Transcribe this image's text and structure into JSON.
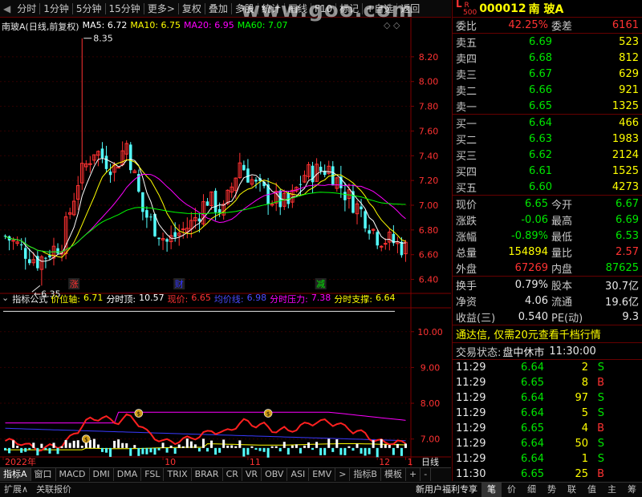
{
  "toolbar": {
    "tabs": [
      "分时",
      "1分钟",
      "5分钟",
      "15分钟",
      "更多>"
    ],
    "buttons": [
      "复权",
      "叠加",
      "多股",
      "统计",
      "画线",
      "F10",
      "标记",
      "+自选",
      "返回"
    ]
  },
  "watermark": "www.goo.com",
  "legend": {
    "title": "南玻A(日线,前复权)",
    "items": [
      {
        "label": "MA5: 6.72",
        "color": "#ffffff"
      },
      {
        "label": "MA10: 6.75",
        "color": "#ffff00"
      },
      {
        "label": "MA20: 6.95",
        "color": "#ff00ff"
      },
      {
        "label": "MA60: 7.07",
        "color": "#00ff00"
      }
    ]
  },
  "indicator_legend": {
    "name": "指标公式",
    "items": [
      {
        "label": "价位轴:",
        "value": "6.71",
        "color": "#ffff00"
      },
      {
        "label": "分时顶:",
        "value": "10.57",
        "color": "#ffffff"
      },
      {
        "label": "现价:",
        "value": "6.65",
        "color": "#ff3232"
      },
      {
        "label": "均价线:",
        "value": "6.98",
        "color": "#3232ff"
      },
      {
        "label": "分时压力:",
        "value": "7.38",
        "color": "#ff00ff"
      },
      {
        "label": "分时支撑:",
        "value": "6.64",
        "color": "#ffff00"
      }
    ]
  },
  "chart_data": [
    {
      "type": "candlestick",
      "ylim": [
        6.3,
        8.4
      ],
      "yticks": [
        "8.20",
        "8.00",
        "7.80",
        "7.60",
        "7.40",
        "7.20",
        "7.00",
        "6.80",
        "6.60",
        "6.40"
      ],
      "ytick_values": [
        8.2,
        8.0,
        7.8,
        7.6,
        7.4,
        7.2,
        7.0,
        6.8,
        6.6,
        6.4
      ],
      "annotations": [
        {
          "text": "8.35",
          "kind": "high"
        },
        {
          "text": "6.35",
          "kind": "low"
        }
      ],
      "markers": [
        {
          "text": "涨",
          "color": "#ff3232"
        },
        {
          "text": "财",
          "color": "#3232ff"
        },
        {
          "text": "减",
          "color": "#00e600"
        }
      ],
      "ma_colors": {
        "ma5": "#ffffff",
        "ma10": "#ffff00",
        "ma20": "#ff00ff",
        "ma60": "#00ff00"
      }
    },
    {
      "type": "line",
      "ylim": [
        6.5,
        10.6
      ],
      "yticks": [
        "10.00",
        "9.00",
        "8.00",
        "7.00"
      ],
      "ytick_values": [
        10,
        9,
        8,
        7
      ]
    }
  ],
  "xaxis": {
    "labels": [
      "2022年",
      "10",
      "11",
      "12",
      "1"
    ],
    "right_label": "日线"
  },
  "bottom_tabs": [
    "指标A",
    "窗口",
    "MACD",
    "DMI",
    "DMA",
    "FSL",
    "TRIX",
    "BRAR",
    "CR",
    "VR",
    "OBV",
    "ASI",
    "EMV",
    ">",
    "指标B",
    "模板",
    "+",
    "-"
  ],
  "statusbar": {
    "items": [
      "扩展∧",
      "关联报价"
    ],
    "right": "新用户福利专享"
  },
  "side_tabs": [
    "笔",
    "价",
    "细",
    "势",
    "联",
    "值",
    "主",
    "筹"
  ],
  "quote": {
    "header": {
      "badge_l": "L",
      "badge_r": "R",
      "badge_sub": "500",
      "code": "000012",
      "name": "南 玻A"
    },
    "weibi": {
      "label": "委比",
      "value": "42.25%",
      "label2": "委差",
      "value2": "6161"
    },
    "asks": [
      {
        "label": "卖五",
        "price": "6.69",
        "vol": "523"
      },
      {
        "label": "卖四",
        "price": "6.68",
        "vol": "812"
      },
      {
        "label": "卖三",
        "price": "6.67",
        "vol": "629"
      },
      {
        "label": "卖二",
        "price": "6.66",
        "vol": "921"
      },
      {
        "label": "卖一",
        "price": "6.65",
        "vol": "1325"
      }
    ],
    "bids": [
      {
        "label": "买一",
        "price": "6.64",
        "vol": "466"
      },
      {
        "label": "买二",
        "price": "6.63",
        "vol": "1983"
      },
      {
        "label": "买三",
        "price": "6.62",
        "vol": "2124"
      },
      {
        "label": "买四",
        "price": "6.61",
        "vol": "1525"
      },
      {
        "label": "买五",
        "price": "6.60",
        "vol": "4273"
      }
    ],
    "stats": [
      {
        "l1": "现价",
        "v1": "6.65",
        "c1": "green",
        "l2": "今开",
        "v2": "6.67",
        "c2": "green"
      },
      {
        "l1": "涨跌",
        "v1": "-0.06",
        "c1": "green",
        "l2": "最高",
        "v2": "6.69",
        "c2": "green"
      },
      {
        "l1": "涨幅",
        "v1": "-0.89%",
        "c1": "green",
        "l2": "最低",
        "v2": "6.53",
        "c2": "green"
      },
      {
        "l1": "总量",
        "v1": "154894",
        "c1": "yellow",
        "l2": "量比",
        "v2": "2.57",
        "c2": "red"
      },
      {
        "l1": "外盘",
        "v1": "67269",
        "c1": "red",
        "l2": "内盘",
        "v2": "87625",
        "c2": "green"
      }
    ],
    "stats2": [
      {
        "l1": "换手",
        "v1": "0.79%",
        "l2": "股本",
        "v2": "30.7亿"
      },
      {
        "l1": "净资",
        "v1": "4.06",
        "l2": "流通",
        "v2": "19.6亿"
      },
      {
        "l1": "收益(三)",
        "v1": "0.540",
        "l2": "PE(动)",
        "v2": "9.3"
      }
    ],
    "ad": "通达信, 仅需20元查看千档行情",
    "trade_state": {
      "label": "交易状态:",
      "value": "盘中休市",
      "time": "11:30:00"
    },
    "ticks": [
      {
        "time": "11:29",
        "price": "6.64",
        "vol": "2",
        "side": "S"
      },
      {
        "time": "11:29",
        "price": "6.65",
        "vol": "8",
        "side": "B"
      },
      {
        "time": "11:29",
        "price": "6.64",
        "vol": "97",
        "side": "S"
      },
      {
        "time": "11:29",
        "price": "6.64",
        "vol": "5",
        "side": "S"
      },
      {
        "time": "11:29",
        "price": "6.65",
        "vol": "4",
        "side": "B"
      },
      {
        "time": "11:29",
        "price": "6.64",
        "vol": "50",
        "side": "S"
      },
      {
        "time": "11:29",
        "price": "6.64",
        "vol": "1",
        "side": "S"
      },
      {
        "time": "11:30",
        "price": "6.65",
        "vol": "25",
        "side": "B"
      }
    ]
  },
  "colors": {
    "up": "#ff3232",
    "down": "#54fcfc",
    "border": "#800000",
    "grid": "#330000"
  }
}
